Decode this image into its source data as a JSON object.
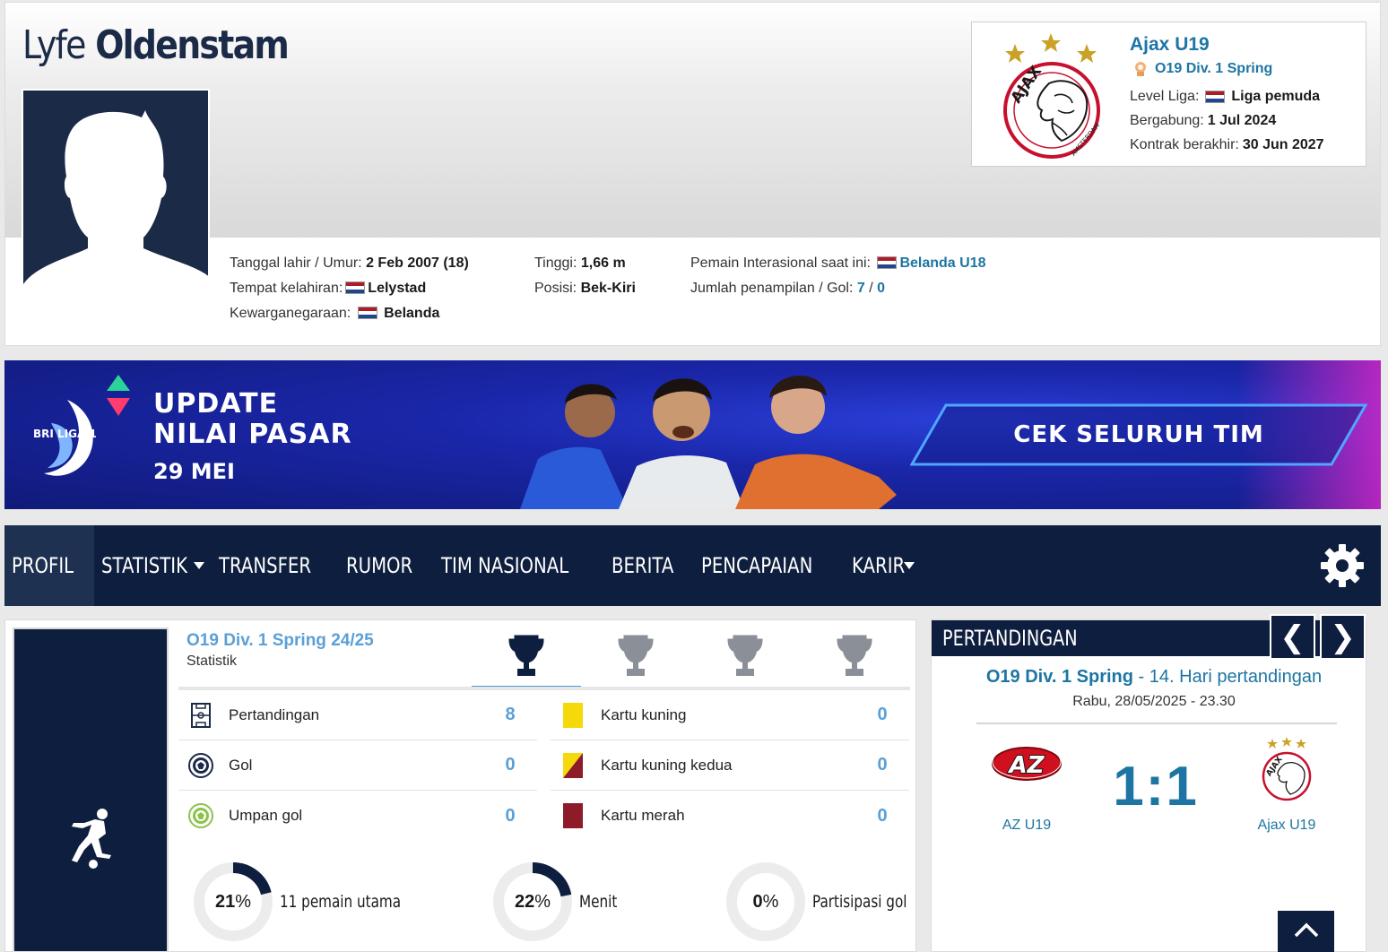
{
  "player": {
    "first_name": "Lyfe",
    "last_name": "Oldenstam"
  },
  "club": {
    "name": "Ajax U19",
    "league": "O19 Div. 1 Spring",
    "level_label": "Level Liga:",
    "level_value": "Liga pemuda",
    "joined_label": "Bergabung:",
    "joined_value": "1 Jul 2024",
    "contract_label": "Kontrak berakhir:",
    "contract_value": "30 Jun 2027"
  },
  "info": {
    "dob_label": "Tanggal lahir / Umur:",
    "dob_value": "2 Feb 2007 (18)",
    "birthplace_label": "Tempat kelahiran:",
    "birthplace_value": "Lelystad",
    "citizenship_label": "Kewarganegaraan:",
    "citizenship_value": "Belanda",
    "height_label": "Tinggi:",
    "height_value": "1,66 m",
    "position_label": "Posisi:",
    "position_value": "Bek-Kiri",
    "intl_label": "Pemain Interasional saat ini:",
    "intl_value": "Belanda U18",
    "caps_label": "Jumlah penampilan / Gol:",
    "caps_value": "7",
    "caps_sep": "/",
    "goals_value": "0"
  },
  "banner": {
    "logo_text": "BRI LIGA 1",
    "title_line1": "UPDATE",
    "title_line2": "NILAI PASAR",
    "date": "29 MEI",
    "cta": "CEK SELURUH TIM"
  },
  "nav": {
    "tabs": [
      {
        "label": "PROFIL"
      },
      {
        "label": "STATISTIK"
      },
      {
        "label": "TRANSFER"
      },
      {
        "label": "RUMOR"
      },
      {
        "label": "TIM NASIONAL"
      },
      {
        "label": "BERITA"
      },
      {
        "label": "PENCAPAIAN"
      },
      {
        "label": "KARIR"
      }
    ],
    "active_index": 0
  },
  "stats": {
    "league": "O19 Div. 1 Spring 24/25",
    "subtitle": "Statistik",
    "rows_left": [
      {
        "label": "Pertandingan",
        "value": "8",
        "icon": "pitch-icon"
      },
      {
        "label": "Gol",
        "value": "0",
        "icon": "ball-icon"
      },
      {
        "label": "Umpan gol",
        "value": "0",
        "icon": "assist-icon"
      }
    ],
    "rows_right": [
      {
        "label": "Kartu kuning",
        "value": "0",
        "icon": "yellow-card-icon",
        "color": "#f5d90a"
      },
      {
        "label": "Kartu kuning kedua",
        "value": "0",
        "icon": "second-yellow-icon",
        "color": "#f5d90a"
      },
      {
        "label": "Kartu merah",
        "value": "0",
        "icon": "red-card-icon",
        "color": "#8e1b2a"
      }
    ],
    "donuts": [
      {
        "pct": "21",
        "sign": "%",
        "label": "11 pemain utama",
        "fraction": 0.21
      },
      {
        "pct": "22",
        "sign": "%",
        "label": "Menit",
        "fraction": 0.22
      },
      {
        "pct": "0",
        "sign": "%",
        "label": "Partisipasi gol",
        "fraction": 0
      }
    ]
  },
  "match": {
    "title": "PERTANDINGAN",
    "league": "O19 Div. 1 Spring",
    "round": "- 14. Hari pertandingan",
    "date": "Rabu, 28/05/2025 - 23.30",
    "home": "AZ U19",
    "away": "Ajax U19",
    "score": "1:1",
    "prev": "❮",
    "next": "❯"
  },
  "colors": {
    "navy": "#0e1e3e",
    "link": "#1d75a3",
    "stat_value": "#5aa0d8"
  }
}
